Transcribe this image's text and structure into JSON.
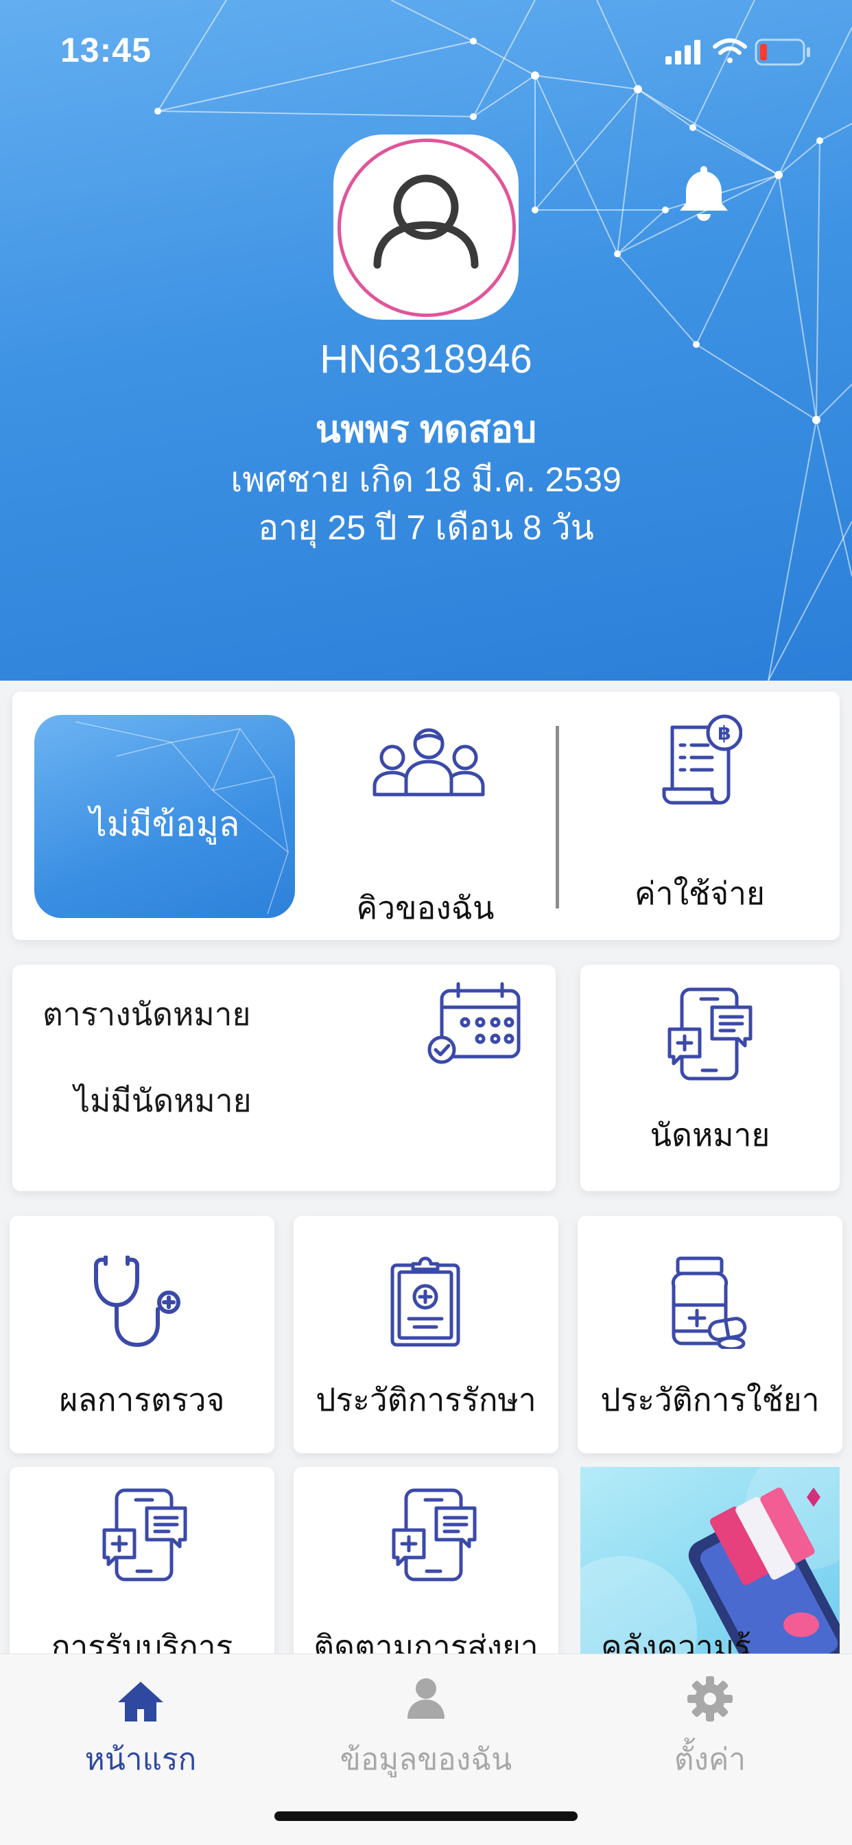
{
  "status": {
    "time": "13:45"
  },
  "patient": {
    "hn": "HN6318946",
    "name": "นพพร  ทดสอบ",
    "gender_birth": "เพศชาย เกิด 18 มี.ค. 2539",
    "age": "อายุ 25 ปี 7 เดือน 8 วัน"
  },
  "menu": {
    "no_data_label": "ไม่มีข้อมูล",
    "queue_label": "คิวของฉัน",
    "expense_label": "ค่าใช้จ่าย",
    "schedule_title": "ตารางนัดหมาย",
    "schedule_empty": "ไม่มีนัดหมาย",
    "appointment_label": "นัดหมาย",
    "lab_results_label": "ผลการตรวจ",
    "treatment_history_label": "ประวัติการรักษา",
    "medication_history_label": "ประวัติการใช้ยา",
    "services_label": "การรับบริการ",
    "delivery_tracking_label": "ติดตามการส่งยา",
    "knowledge_label": "คลังความรู้"
  },
  "tabs": [
    {
      "label": "หน้าแรก",
      "icon": "home-icon",
      "active": true
    },
    {
      "label": "ข้อมูลของฉัน",
      "icon": "person-icon",
      "active": false
    },
    {
      "label": "ตั้งค่า",
      "icon": "gear-icon",
      "active": false
    }
  ],
  "colors": {
    "header_blue": "#3f93e4",
    "icon_blue": "#3b4aa8",
    "avatar_ring": "#e0559a",
    "tab_active": "#2f49a0",
    "tab_inactive": "#a8a8a8"
  }
}
